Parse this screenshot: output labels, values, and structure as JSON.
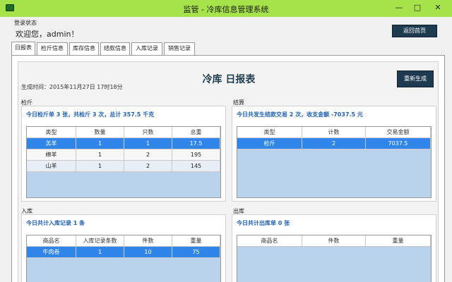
{
  "window": {
    "title": "监管 - 冷库信息管理系统",
    "min_glyph": "—",
    "max_glyph": "□",
    "close_glyph": "✕"
  },
  "header": {
    "login_label": "登录状态",
    "welcome": "欢迎您，admin！",
    "return_label": "返回首页"
  },
  "tabs": [
    "日报表",
    "检斤信息",
    "库存信息",
    "结款信息",
    "入库记录",
    "销售记录"
  ],
  "report": {
    "title": "冷库 日报表",
    "generated": "生成时间：2015年11月27日 17时18分",
    "regenerate_label": "重新生成"
  },
  "weighing": {
    "label": "检斤",
    "summary": "今日检斤单 3 张，共检斤 3 次，总计 357.5 千克",
    "headers": [
      "类型",
      "数量",
      "只数",
      "总重"
    ],
    "rows": [
      [
        "羔羊",
        "1",
        "1",
        "17.5"
      ],
      [
        "绵羊",
        "1",
        "2",
        "195"
      ],
      [
        "山羊",
        "1",
        "2",
        "145"
      ]
    ]
  },
  "settlement": {
    "label": "结算",
    "summary": "今日共发生结款交易 2 次，收支金额 -7037.5 元",
    "headers": [
      "类型",
      "计数",
      "交易金额"
    ],
    "rows": [
      [
        "检斤",
        "2",
        "7037.5"
      ]
    ]
  },
  "inbound": {
    "label": "入库",
    "summary": "今日共计入库记录 1 条",
    "headers": [
      "商品名",
      "入库记录条数",
      "件数",
      "重量"
    ],
    "rows": [
      [
        "牛肉卷",
        "1",
        "10",
        "75"
      ]
    ]
  },
  "outbound": {
    "label": "出库",
    "summary": "今日共计出库单 0 张",
    "headers": [
      "商品名",
      "件数",
      "重量"
    ],
    "rows": []
  }
}
